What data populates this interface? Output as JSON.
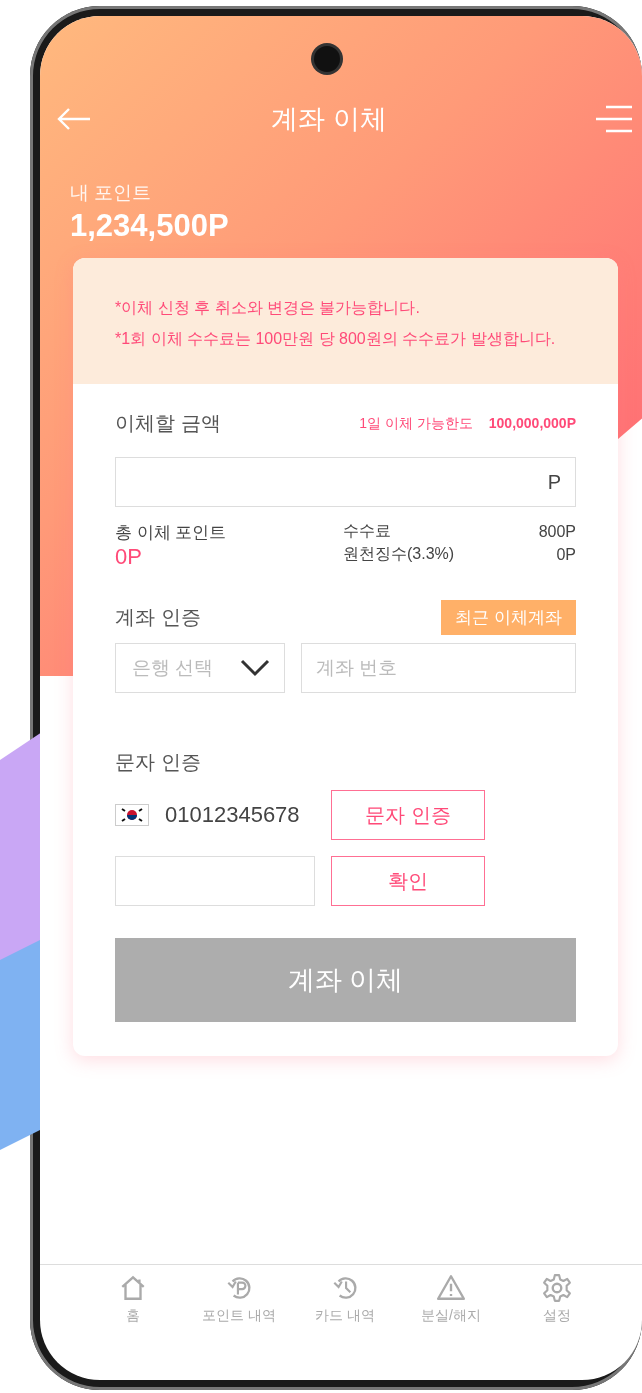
{
  "header": {
    "title": "계좌 이체"
  },
  "points": {
    "label": "내 포인트",
    "value": "1,234,500P"
  },
  "notices": [
    "*이체 신청 후 취소와 변경은 불가능합니다.",
    "*1회 이체 수수료는 100만원 당 800원의 수수료가 발생합니다."
  ],
  "amount": {
    "label": "이체할 금액",
    "limit_label": "1일 이체 가능한도",
    "limit_value": "100,000,000P",
    "unit": "P"
  },
  "summary": {
    "total_label": "총 이체 포인트",
    "total_value": "0P",
    "fees": [
      {
        "label": "수수료",
        "value": "800P"
      },
      {
        "label": "원천징수(3.3%)",
        "value": "0P"
      }
    ]
  },
  "account": {
    "label": "계좌 인증",
    "recent_button": "최근 이체계좌",
    "bank_select": {
      "placeholder": "은행 선택"
    },
    "account_number": {
      "placeholder": "계좌 번호"
    }
  },
  "sms": {
    "label": "문자 인증",
    "phone": "01012345678",
    "send_button": "문자 인증",
    "confirm_button": "확인"
  },
  "submit": {
    "label": "계좌 이체",
    "disabled": true
  },
  "nav": [
    {
      "label": "홈",
      "kind": "home"
    },
    {
      "label": "포인트 내역",
      "kind": "points"
    },
    {
      "label": "카드 내역",
      "kind": "history"
    },
    {
      "label": "분실/해지",
      "kind": "warning"
    },
    {
      "label": "설정",
      "kind": "settings"
    }
  ]
}
